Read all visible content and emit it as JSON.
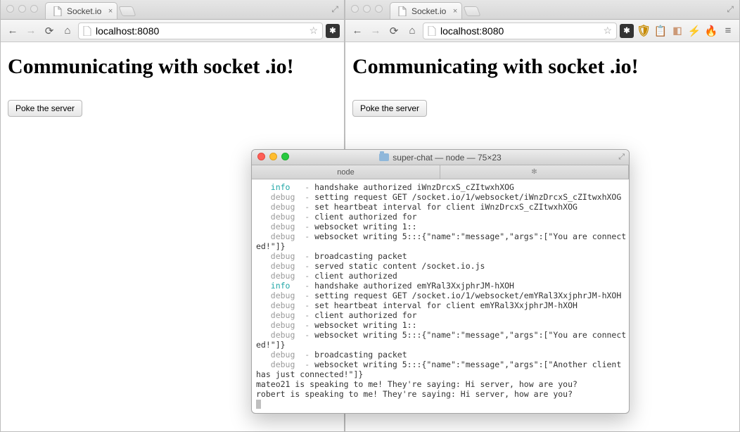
{
  "browsers": {
    "left": {
      "tab_title": "Socket.io",
      "url": "localhost:8080",
      "heading": "Communicating with socket .io!",
      "poke_label": "Poke the server"
    },
    "right": {
      "tab_title": "Socket.io",
      "url": "localhost:8080",
      "heading": "Communicating with socket .io!",
      "poke_label": "Poke the server"
    }
  },
  "terminal": {
    "title": "super-chat — node — 75×23",
    "tab_label": "node",
    "lines": [
      {
        "level": "info",
        "msg": "handshake authorized iWnzDrcxS_cZItwxhXOG"
      },
      {
        "level": "debug",
        "msg": "setting request GET /socket.io/1/websocket/iWnzDrcxS_cZItwxhXOG"
      },
      {
        "level": "debug",
        "msg": "set heartbeat interval for client iWnzDrcxS_cZItwxhXOG"
      },
      {
        "level": "debug",
        "msg": "client authorized for"
      },
      {
        "level": "debug",
        "msg": "websocket writing 1::"
      },
      {
        "level": "debug",
        "msg": "websocket writing 5:::{\"name\":\"message\",\"args\":[\"You are connect"
      },
      {
        "level": "",
        "msg": "ed!\"]}"
      },
      {
        "level": "debug",
        "msg": "broadcasting packet"
      },
      {
        "level": "debug",
        "msg": "served static content /socket.io.js"
      },
      {
        "level": "debug",
        "msg": "client authorized"
      },
      {
        "level": "info",
        "msg": "handshake authorized emYRal3XxjphrJM-hXOH"
      },
      {
        "level": "debug",
        "msg": "setting request GET /socket.io/1/websocket/emYRal3XxjphrJM-hXOH"
      },
      {
        "level": "debug",
        "msg": "set heartbeat interval for client emYRal3XxjphrJM-hXOH"
      },
      {
        "level": "debug",
        "msg": "client authorized for"
      },
      {
        "level": "debug",
        "msg": "websocket writing 1::"
      },
      {
        "level": "debug",
        "msg": "websocket writing 5:::{\"name\":\"message\",\"args\":[\"You are connect"
      },
      {
        "level": "",
        "msg": "ed!\"]}"
      },
      {
        "level": "debug",
        "msg": "broadcasting packet"
      },
      {
        "level": "debug",
        "msg": "websocket writing 5:::{\"name\":\"message\",\"args\":[\"Another client "
      },
      {
        "level": "",
        "msg": "has just connected!\"]}"
      },
      {
        "level": "",
        "msg": "mateo21 is speaking to me! They're saying: Hi server, how are you?"
      },
      {
        "level": "",
        "msg": "robert is speaking to me! They're saying: Hi server, how are you?"
      }
    ]
  }
}
